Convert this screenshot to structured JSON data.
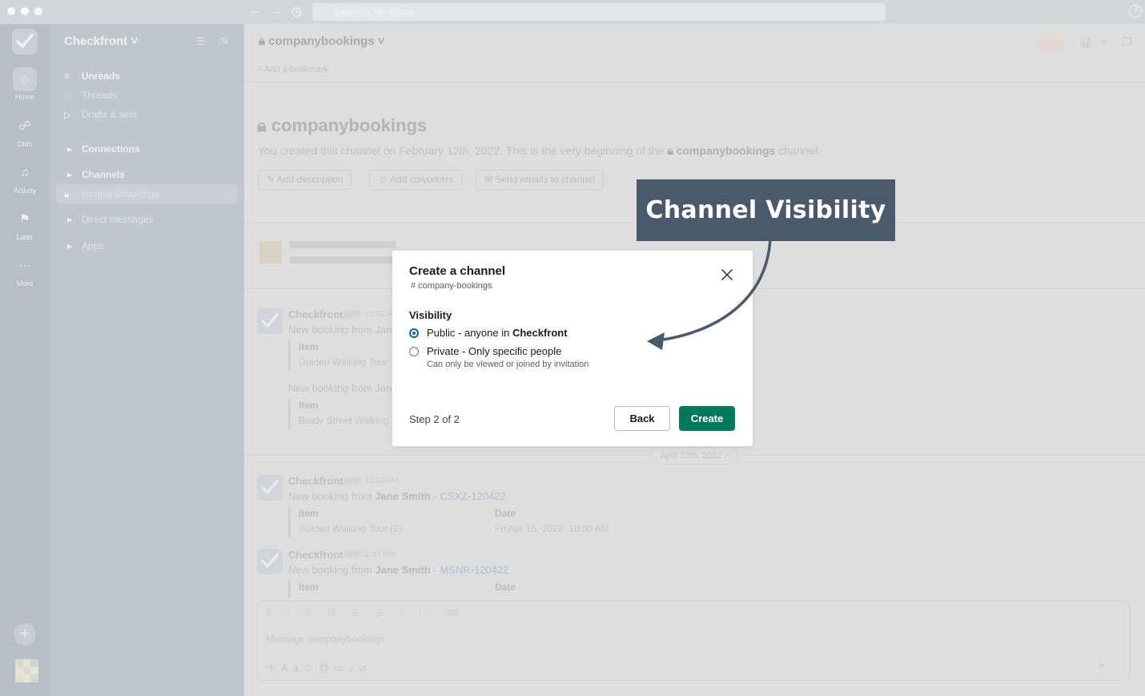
{
  "topbar": {
    "search_placeholder": "Search Checkfront",
    "help_glyph": "?"
  },
  "rail": {
    "items": [
      {
        "label": "Home",
        "icon": "home-icon"
      },
      {
        "label": "DMs",
        "icon": "dms-icon"
      },
      {
        "label": "Activity",
        "icon": "bell-icon"
      },
      {
        "label": "Later",
        "icon": "bookmark-icon"
      },
      {
        "label": "More",
        "icon": "ellipsis-icon"
      }
    ]
  },
  "sidebar": {
    "workspace": "Checkfront",
    "items": [
      {
        "label": "Unreads"
      },
      {
        "label": "Threads"
      },
      {
        "label": "Drafts & sent"
      }
    ],
    "sections": {
      "connections": "Connections",
      "channels": "Channels",
      "selected_channel": "companybookings",
      "direct_messages": "Direct messages",
      "apps": "Apps"
    }
  },
  "channel": {
    "name": "companybookings",
    "bookmark": "+ Add a bookmark",
    "intro_prefix": "You created this channel on February 12th, 2022. This is the very beginning of the",
    "intro_suffix": "channel.",
    "buttons": {
      "add_description": "Add description",
      "add_coworkers": "Add coworkers",
      "send_emails": "Send emails to channel"
    },
    "date_divider": "April 12th, 2022"
  },
  "messages": [
    {
      "sender": "Checkfront",
      "badge": "APP",
      "time": "10:52 AM",
      "text": "New booking from Jane",
      "item_header": "Item",
      "item_value": "Guided Walking Tour"
    },
    {
      "sender": "",
      "badge": "",
      "time": "",
      "text": "New booking from Jane",
      "item_header": "Item",
      "item_value": "Brady Street Walking"
    },
    {
      "sender": "Checkfront",
      "badge": "APP",
      "time": "11:53 AM",
      "text": "New booking from",
      "booker": "Jane Smith",
      "code": "CSXZ-120422",
      "item_header": "Item",
      "item_value": "Guided Walking Tour (2)",
      "date_header": "Date",
      "date_value": "Fri Apr 15, 2022, 10:00 AM"
    },
    {
      "sender": "Checkfront",
      "badge": "APP",
      "time": "2:43 PM",
      "text": "New booking from",
      "booker": "Jane Smith",
      "code": "MSNR-120422",
      "item_header": "Item",
      "date_header": "Date"
    }
  ],
  "composer": {
    "placeholder": "Message companybookings"
  },
  "modal": {
    "title": "Create a channel",
    "subtitle": "# company-bookings",
    "visibility_label": "Visibility",
    "options": [
      {
        "prefix": "Public - anyone in ",
        "bold": "Checkfront",
        "selected": true
      },
      {
        "prefix": "Private - Only specific people",
        "bold": "",
        "selected": false
      }
    ],
    "private_hint": "Can only be viewed or joined by invitation",
    "step": "Step 2 of 2",
    "back_label": "Back",
    "create_label": "Create"
  },
  "callout": {
    "text": "Channel Visibility",
    "color": "#4a5a6b"
  },
  "colors": {
    "create_button": "#007a5a",
    "radio_selected": "#1264a3",
    "link": "#1264a3"
  }
}
